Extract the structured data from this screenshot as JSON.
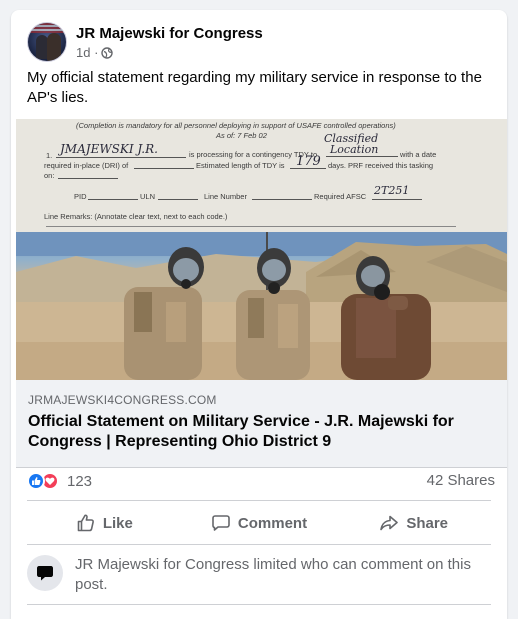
{
  "post": {
    "author": "JR Majewski for Congress",
    "time": "1d",
    "privacy_icon": "globe-icon",
    "text": "My official statement regarding my military service in response to the AP's lies."
  },
  "document": {
    "line1": "(Completion is mandatory for all personnel deploying in support of USAFE controlled operations)",
    "asof": "As of: 7 Feb 02",
    "item_num": "1.",
    "name_hand": "JMAJEWSKI J.R.",
    "processing": "is processing for a contingency TDY to",
    "location_hand1": "Classified",
    "location_hand2": "Location",
    "with_date": "with a date",
    "required": "required in-place (DRI) of",
    "estimated": "Estimated length of TDY is",
    "days_hand": "179",
    "days": "days.  PRF received this tasking",
    "on": "on:",
    "pid": "PID",
    "uln": "ULN",
    "line_number": "Line Number",
    "afsc": "Required AFSC",
    "afsc_hand": "2T251",
    "remarks": "Line Remarks: (Annotate clear text, next to each code.)"
  },
  "link": {
    "domain": "JRMAJEWSKI4CONGRESS.COM",
    "title": "Official Statement on Military Service - J.R. Majewski for Congress | Representing Ohio District 9"
  },
  "stats": {
    "reaction_count": "123",
    "shares": "42 Shares"
  },
  "actions": {
    "like": "Like",
    "comment": "Comment",
    "share": "Share"
  },
  "notice": "JR Majewski for Congress limited who can comment on this post.",
  "colors": {
    "like_blue": "#1877f2",
    "love_red": "#f33e58",
    "muted_text": "#65676b"
  }
}
